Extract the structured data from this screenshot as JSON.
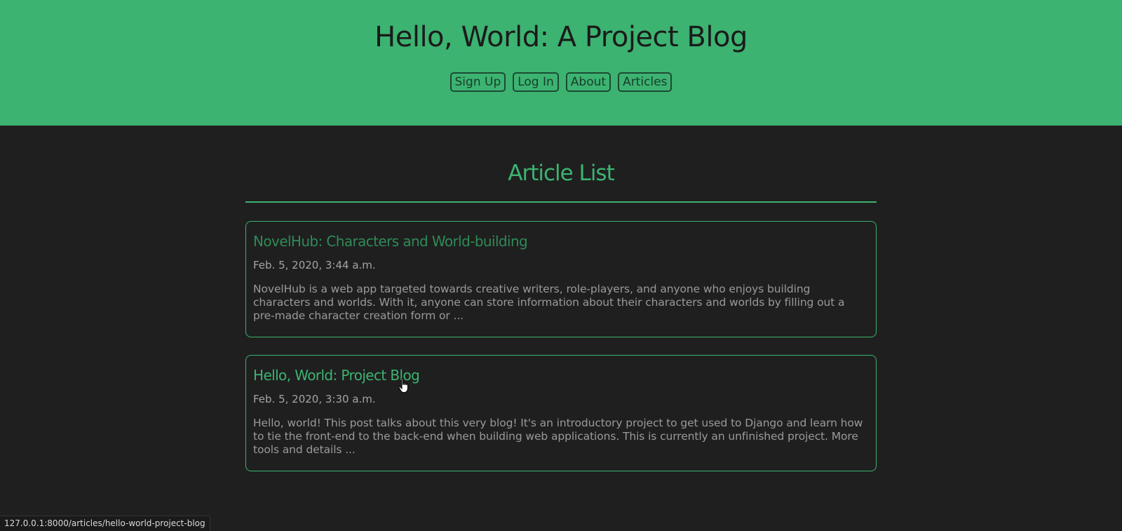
{
  "header": {
    "title": "Hello, World: A Project Blog",
    "nav": [
      "Sign Up",
      "Log In",
      "About",
      "Articles"
    ]
  },
  "main": {
    "heading": "Article List",
    "articles": [
      {
        "title": "NovelHub: Characters and World-building",
        "date": "Feb. 5, 2020, 3:44 a.m.",
        "excerpt": "NovelHub is a web app targeted towards creative writers, role-players, and anyone who enjoys building characters and worlds. With it, anyone can store information about their characters and worlds by filling out a pre-made character creation form or ..."
      },
      {
        "title": "Hello, World: Project Blog",
        "date": "Feb. 5, 2020, 3:30 a.m.",
        "excerpt": "Hello, world! This post talks about this very blog! It's an introductory project to get used to Django and learn how to tie the front-end to the back-end when building web applications. This is currently an unfinished project. More tools and details ..."
      }
    ]
  },
  "status_bar": {
    "url": "127.0.0.1:8000/articles/hello-world-project-blog"
  },
  "colors": {
    "header_bg": "#3cb371",
    "page_bg": "#1f1f1f",
    "accent": "#3cb371"
  },
  "icons": {
    "cursor": "hand-pointer-icon"
  }
}
